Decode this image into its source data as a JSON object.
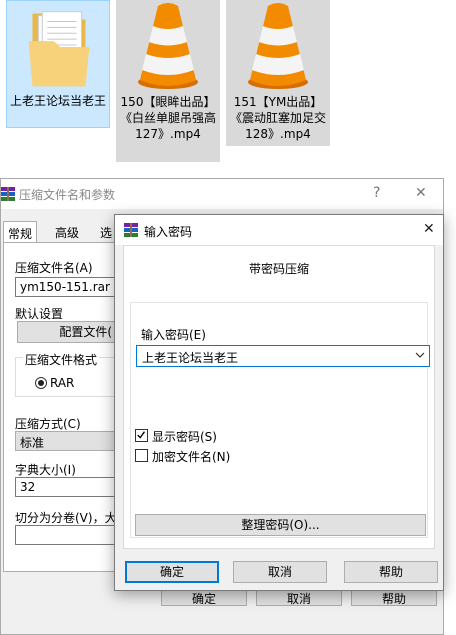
{
  "desktop": {
    "files": [
      {
        "name": "上老王论坛当老王",
        "type": "folder"
      },
      {
        "name": "150【眼眸出品】《白丝单腿吊强高127》.mp4",
        "type": "vlc-video"
      },
      {
        "name": "151【YM出品】《震动肛塞加足交128》.mp4",
        "type": "vlc-video"
      }
    ]
  },
  "back_dialog": {
    "title": "压缩文件名和参数",
    "help_glyph": "?",
    "close_glyph": "✕",
    "tabs": [
      "常规",
      "高级",
      "选"
    ],
    "archive_name_label": "压缩文件名(A)",
    "archive_name_value": "ym150-151.rar",
    "default_settings_label": "默认设置",
    "profiles_button": "配置文件(",
    "format_group_label": "压缩文件格式",
    "format_rar": "RAR",
    "method_label": "压缩方式(C)",
    "method_value": "标准",
    "dict_label": "字典大小(I)",
    "dict_value": "32",
    "split_label": "切分为分卷(V)，大",
    "ok_button": "确定",
    "cancel_button": "取消",
    "help_button": "帮助"
  },
  "password_dialog": {
    "title": "输入密码",
    "close_glyph": "✕",
    "heading": "带密码压缩",
    "password_label": "输入密码(E)",
    "password_value": "上老王论坛当老王",
    "show_password_label": "显示密码(S)",
    "show_password_checked": true,
    "encrypt_names_label": "加密文件名(N)",
    "encrypt_names_checked": false,
    "organize_button": "整理密码(O)...",
    "ok_button": "确定",
    "cancel_button": "取消",
    "help_button": "帮助"
  },
  "colors": {
    "selection_bg": "#cce8ff",
    "accent": "#0078d7",
    "vlc_orange": "#f28b00"
  }
}
